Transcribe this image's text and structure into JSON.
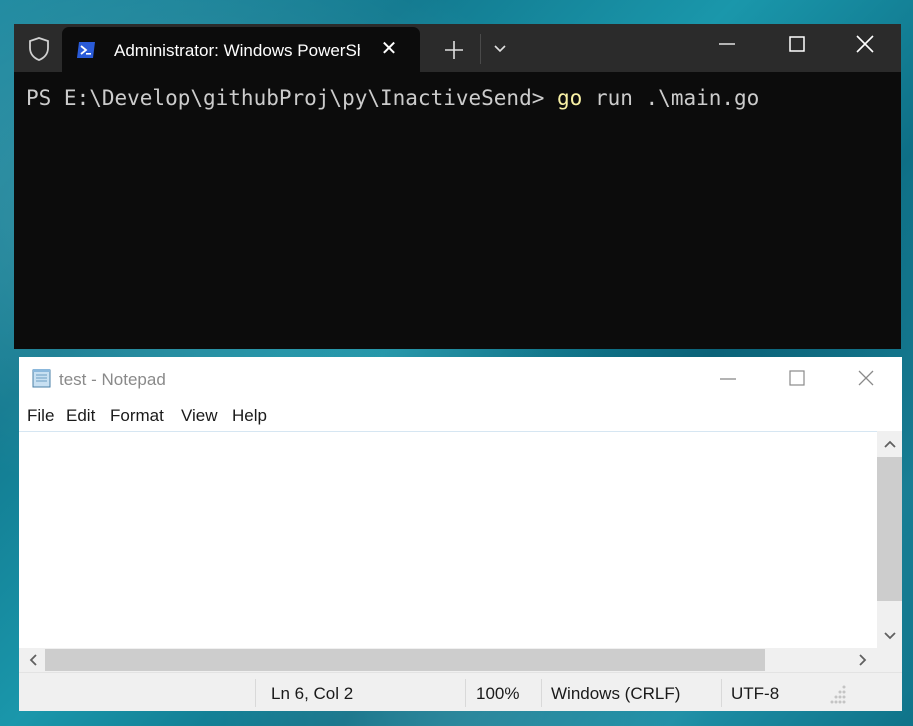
{
  "terminal": {
    "tab_title": "Administrator: Windows PowerShell",
    "prompt": "PS E:\\Develop\\githubProj\\py\\InactiveSend> ",
    "command": "go",
    "args": " run .\\main.go",
    "tab_close_glyph": "✕"
  },
  "notepad": {
    "title": "test - Notepad",
    "menu": [
      "File",
      "Edit",
      "Format",
      "View",
      "Help"
    ],
    "content": "",
    "status": {
      "position": "Ln 6, Col 2",
      "zoom": "100%",
      "line_ending": "Windows (CRLF)",
      "encoding": "UTF-8"
    }
  },
  "colors": {
    "terminal_bg": "#0c0c0c",
    "terminal_title_bg": "#2b2b2b",
    "command_color": "#f9f1a5",
    "powershell_blue": "#2257c7"
  },
  "icons": [
    "shield-icon",
    "powershell-icon",
    "close-icon",
    "plus-icon",
    "chevron-down-icon",
    "minimize-icon",
    "maximize-icon",
    "notepad-icon"
  ]
}
